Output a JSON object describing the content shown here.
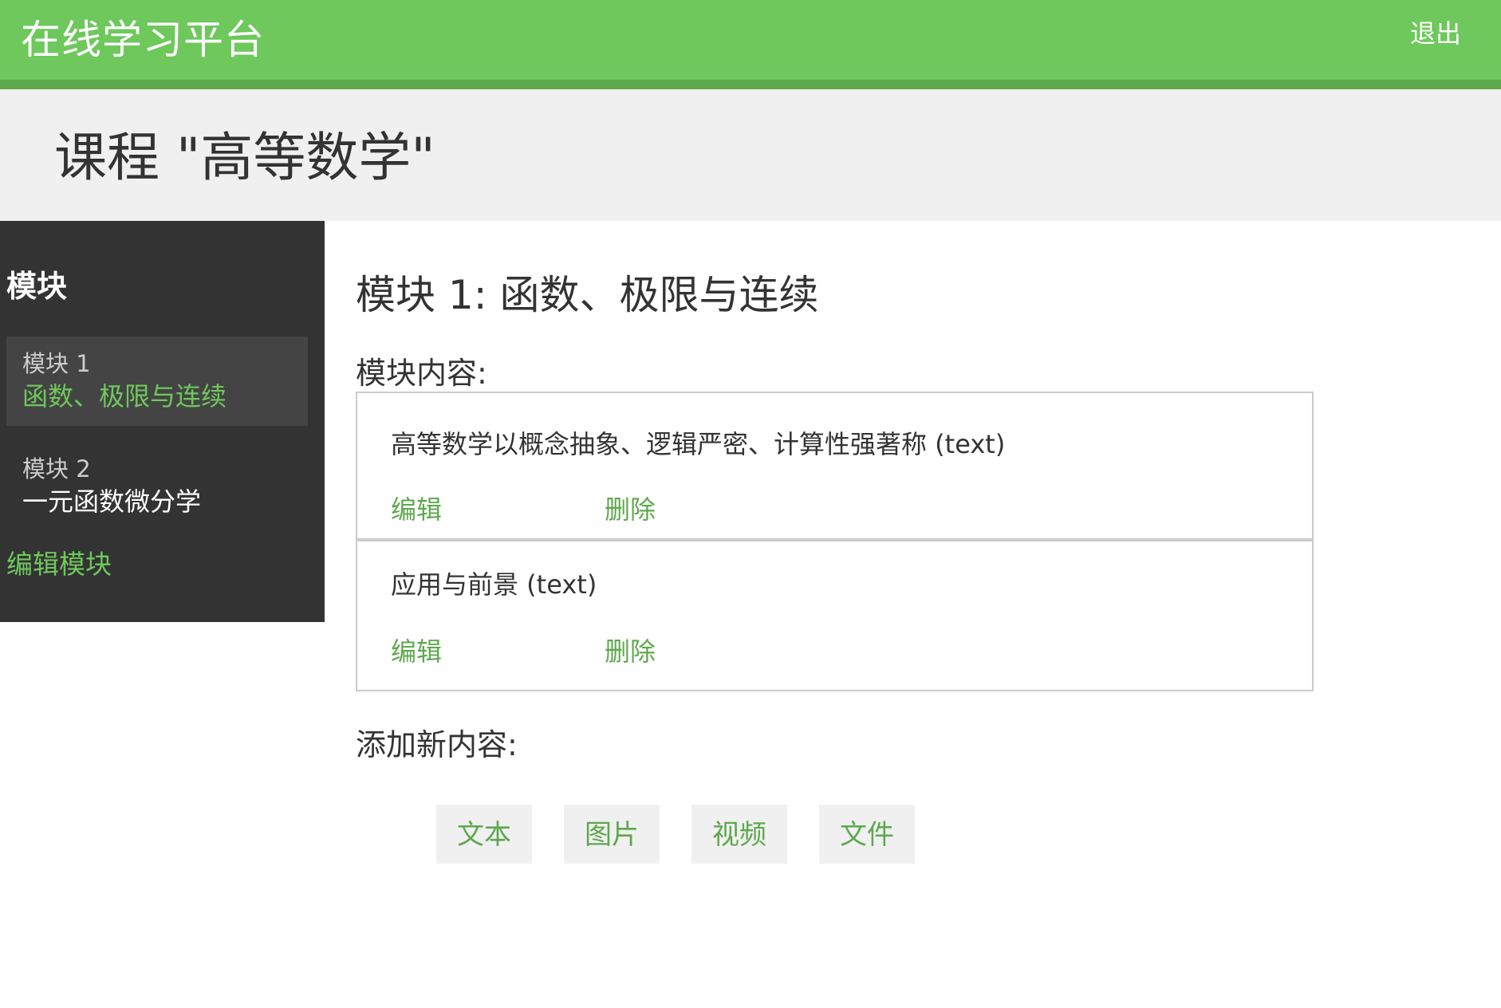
{
  "topbar": {
    "brand": "在线学习平台",
    "logout_label": "退出"
  },
  "course": {
    "title": "课程 \"高等数学\""
  },
  "sidebar": {
    "heading": "模块",
    "modules": [
      {
        "number": "模块 1",
        "name": "函数、极限与连续",
        "active": true
      },
      {
        "number": "模块 2",
        "name": "一元函数微分学",
        "active": false
      }
    ],
    "edit_modules_label": "编辑模块"
  },
  "main": {
    "title": "模块 1: 函数、极限与连续",
    "content_label": "模块内容:",
    "items": [
      {
        "text": "高等数学以概念抽象、逻辑严密、计算性强著称 (text)",
        "edit_label": "编辑",
        "delete_label": "删除"
      },
      {
        "text": "应用与前景 (text)",
        "edit_label": "编辑",
        "delete_label": "删除"
      }
    ],
    "add_label": "添加新内容:",
    "add_buttons": [
      "文本",
      "图片",
      "视频",
      "文件"
    ]
  },
  "colors": {
    "primary_green": "#6ec85c",
    "sidebar_bg": "#333333",
    "header_bg": "#f0f0f0"
  }
}
